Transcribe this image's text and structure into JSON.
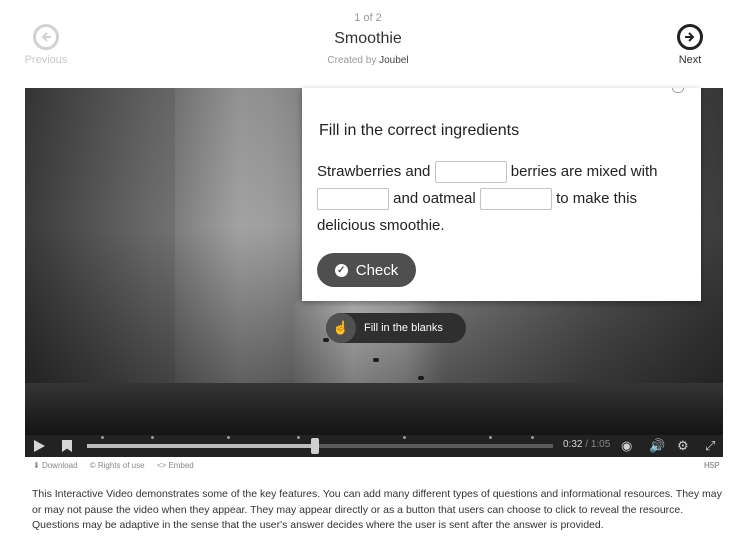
{
  "header": {
    "counter": "1 of 2",
    "title": "Smoothie",
    "created_by_prefix": "Created by",
    "creator": "Joubel",
    "previous_label": "Previous",
    "next_label": "Next"
  },
  "question": {
    "heading": "Fill in the correct ingredients",
    "text_1": "Strawberries and",
    "text_2": "berries are mixed with",
    "text_3": "and oatmeal",
    "text_4": "to make this delicious smoothie.",
    "blanks": [
      "",
      "",
      ""
    ],
    "check_label": "Check"
  },
  "interaction_label": "Fill in the blanks",
  "player": {
    "current_time": "0:32",
    "separator": "/",
    "total_time": "1:05",
    "progress": 0.49
  },
  "footer": {
    "download_label": "Download",
    "rights_label": "Rights of use",
    "embed_label": "Embed",
    "h5p_label": "H5P"
  },
  "description": "This Interactive Video demonstrates some of the key features. You can add many different types of questions and informational resources. They may or may not pause the video when they appear. They may appear directly or as a button that users can choose to click to reveal the resource. Questions may be adaptive in the sense that the user's answer decides where the user is sent after the answer is provided.",
  "icons": {
    "previous": "arrow-left-circle-icon",
    "next": "arrow-right-circle-icon",
    "play": "play-icon",
    "bookmark": "bookmark-icon",
    "volume": "volume-icon",
    "settings": "gear-icon",
    "quality": "quality-icon",
    "fullscreen": "fullscreen-icon",
    "check": "check-circle-icon",
    "hand": "hand-pointer-icon"
  },
  "colors": {
    "accent": "#4f4f4f",
    "next_arrow": "#222222",
    "disabled": "#d2d2d2"
  }
}
